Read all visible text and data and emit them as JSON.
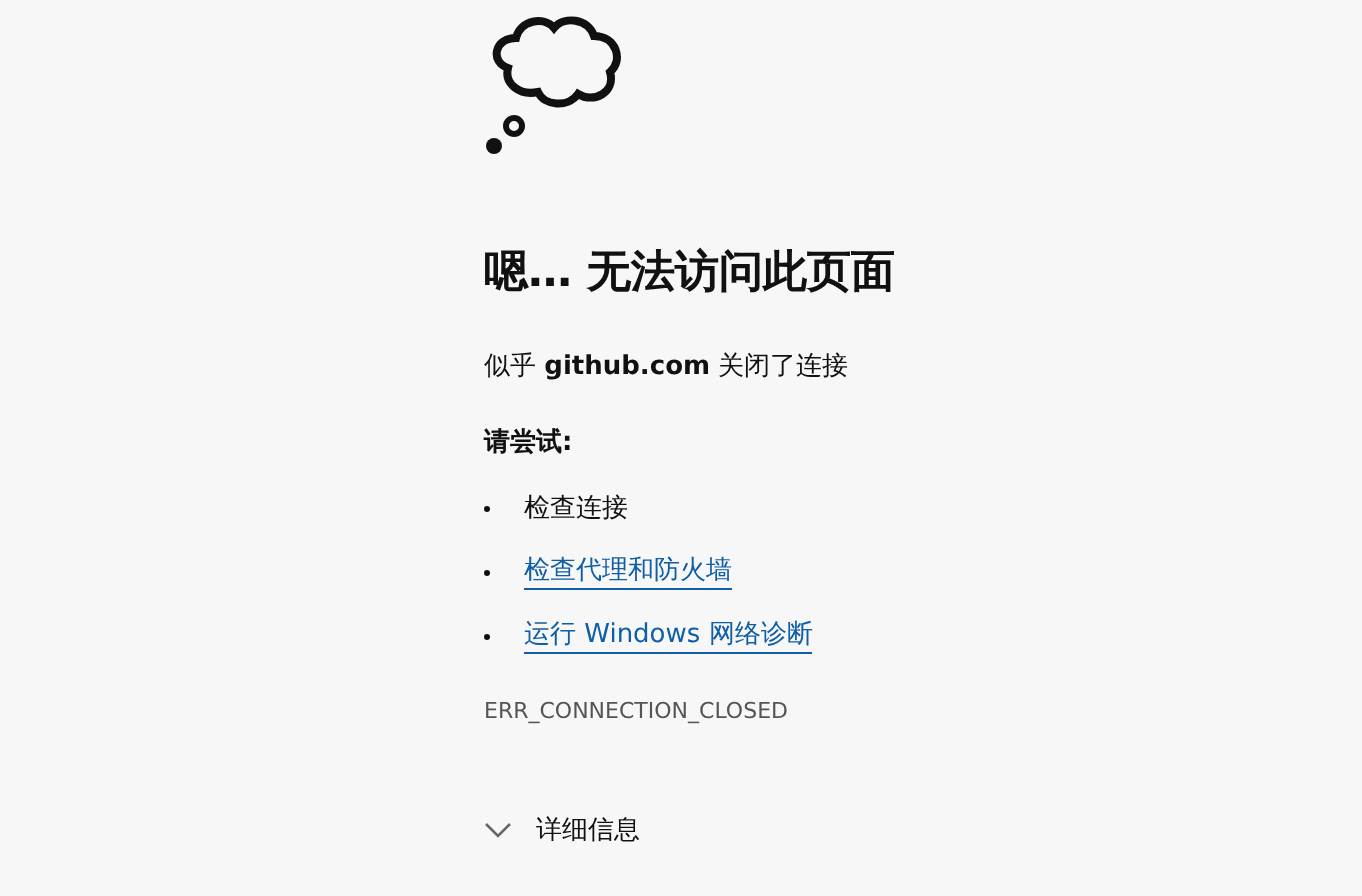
{
  "error_page": {
    "title": "嗯… 无法访问此页面",
    "message": "似乎 **github.com** 关闭了连接",
    "suggestions_heading": "请尝试:",
    "suggestions": [
      {
        "kind": "text",
        "label": "检查连接"
      },
      {
        "kind": "link",
        "label": "检查代理和防火墙"
      },
      {
        "kind": "link",
        "label": "运行 Windows 网络诊断"
      }
    ],
    "error_code": "ERR_CONNECTION_CLOSED",
    "details": {
      "label": "详细信息",
      "expanded": false
    }
  }
}
